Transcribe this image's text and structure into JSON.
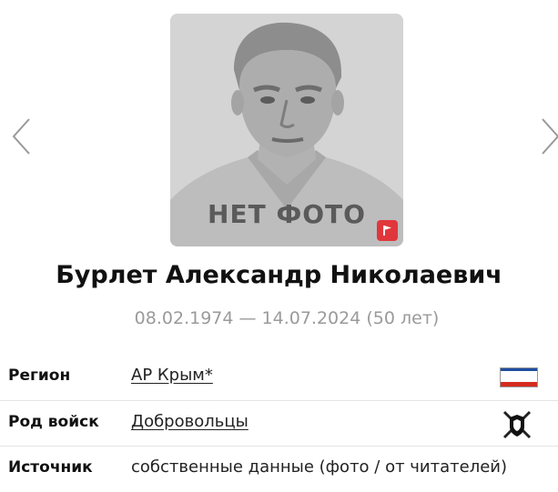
{
  "photo": {
    "placeholder_text": "НЕТ ФОТО",
    "flag_icon": "report-flag-icon",
    "badge_color": "#e0373c"
  },
  "person": {
    "name": "Бурлет Александр Николаевич",
    "dates": "08.02.1974 — 14.07.2024 (50 лет)"
  },
  "rows": [
    {
      "label": "Регион",
      "value": "АР Крым*",
      "icon": "crimea-flag-icon",
      "flag_colors": [
        "#ffffff",
        "#1f4ea1",
        "#d52b1e"
      ]
    },
    {
      "label": "Род войск",
      "value": "Добровольцы",
      "icon": "volunteers-emblem-icon"
    },
    {
      "label": "Источник",
      "value": "собственные данные (фото / от читателей)"
    }
  ],
  "nav": {
    "prev_icon": "chevron-left-icon",
    "next_icon": "chevron-right-icon"
  }
}
